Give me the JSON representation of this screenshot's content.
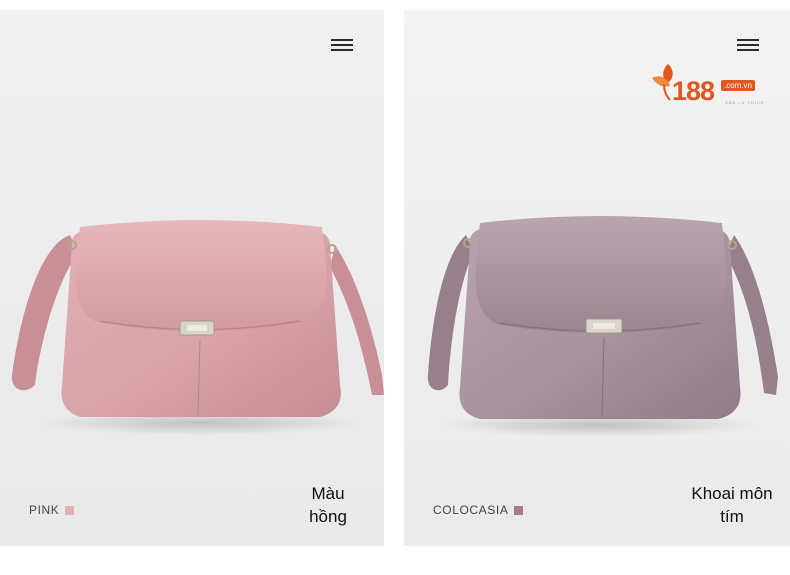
{
  "panels": [
    {
      "color_label": "PINK",
      "swatch_color": "#e3b2b7",
      "caption_line1": "Màu",
      "caption_line2": "hồng",
      "bag_color": "#d7a2a8"
    },
    {
      "color_label": "COLOCASIA",
      "swatch_color": "#a77b8a",
      "caption_line1": "Khoai môn",
      "caption_line2": "tím",
      "bag_color": "#a8929e"
    }
  ],
  "logo": {
    "number": "188",
    "domain": ".com.vn",
    "tagline": "SĂN LÀ THÍCH",
    "brand_color": "#e2561f"
  }
}
